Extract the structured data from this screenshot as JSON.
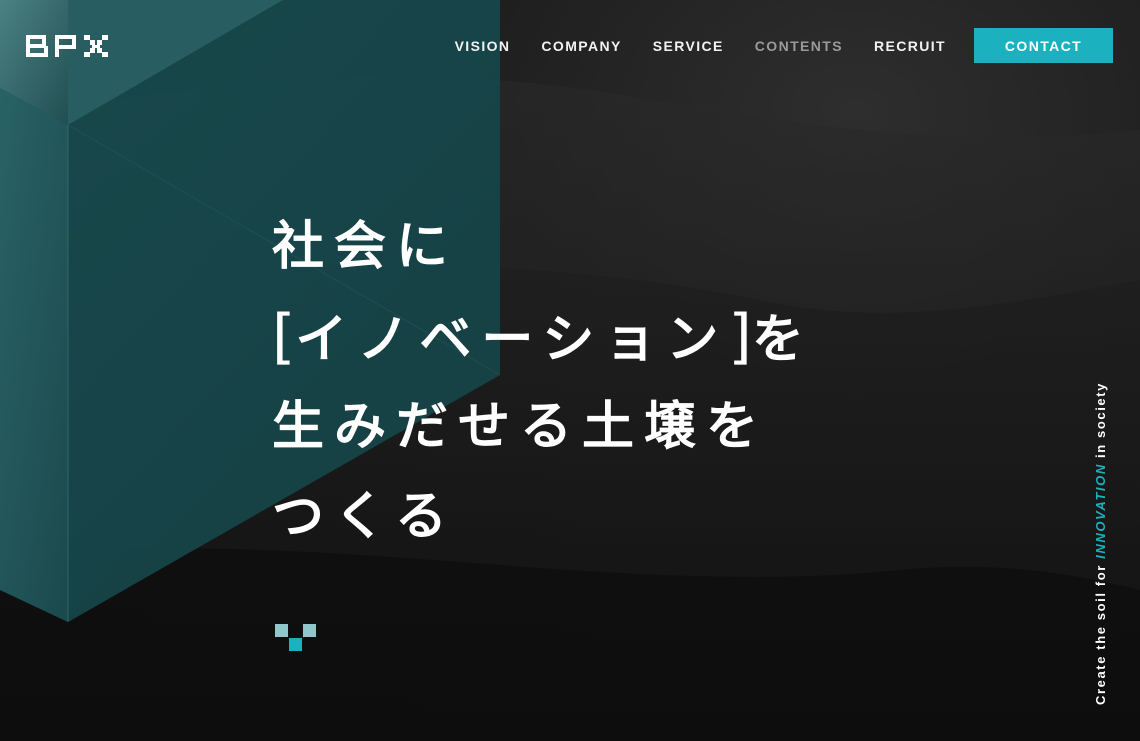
{
  "brand": {
    "logo_text": "BPX"
  },
  "nav": {
    "items": [
      {
        "label": "VISION"
      },
      {
        "label": "COMPANY"
      },
      {
        "label": "SERVICE"
      },
      {
        "label": "CONTENTS"
      },
      {
        "label": "RECRUIT"
      }
    ],
    "contact_label": "CONTACT"
  },
  "hero": {
    "line1": "社会に",
    "bracket_open": "[",
    "line2_word": "イノベーション",
    "bracket_close": "]",
    "line2_suffix": "を",
    "line3": "生みだせる土壌を",
    "line4": "つくる"
  },
  "side_tagline": {
    "before": "Create the soil for ",
    "highlight": "INNOVATION",
    "after": " in society"
  },
  "colors": {
    "accent": "#1cb1bf",
    "background": "#121212",
    "text": "#ffffff",
    "nav_dim": "#9a9a9a"
  },
  "icons": {
    "scroll_indicator": "pixel-chevron-down-icon"
  }
}
